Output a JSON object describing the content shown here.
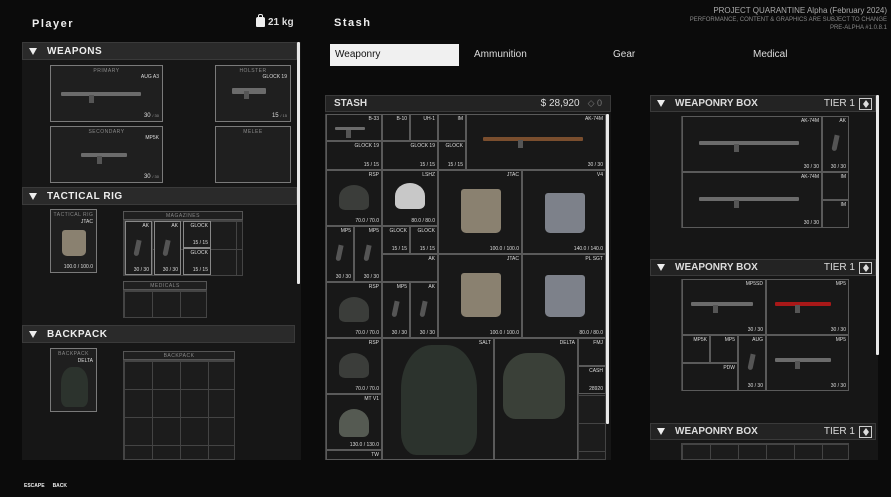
{
  "player": {
    "title": "Player",
    "weight": "21 kg"
  },
  "stash_title": "Stash",
  "build": {
    "line1": "PROJECT QUARANTINE Alpha (February 2024)",
    "line2": "PERFORMANCE, CONTENT & GRAPHICS ARE SUBJECT TO CHANGE",
    "line3": "PRE-ALPHA #1.0.8.1"
  },
  "weapons": {
    "title": "WEAPONS",
    "primary": {
      "label": "PRIMARY",
      "name": "AUG A3",
      "ammo": "30",
      "ammo_max": "/ 30"
    },
    "holster": {
      "label": "HOLSTER",
      "name": "GLOCK 19",
      "ammo": "15",
      "ammo_max": "/ 15"
    },
    "secondary": {
      "label": "SECONDARY",
      "name": "MP5K",
      "ammo": "30",
      "ammo_max": "/ 30"
    },
    "melee": {
      "label": "MELEE"
    }
  },
  "rig": {
    "title": "TACTICAL RIG",
    "slot_label": "TACTICAL RIG",
    "name": "JTAC",
    "capacity": "100.0 / 100.0",
    "magazines_label": "MAGAZINES",
    "mags": [
      {
        "name": "AK",
        "ammo": "30 / 30"
      },
      {
        "name": "AK",
        "ammo": "30 / 30"
      },
      {
        "name": "GLOCK",
        "ammo": "15 / 15"
      },
      {
        "name": "GLOCK",
        "ammo": "15 / 15"
      }
    ],
    "medicals_label": "MEDICALS"
  },
  "backpack": {
    "title": "BACKPACK",
    "slot_label": "BACKPACK",
    "name": "DELTA",
    "grid_label": "BACKPACK"
  },
  "tabs": [
    "Weaponry",
    "Ammunition",
    "Gear",
    "Medical"
  ],
  "stash": {
    "title": "STASH",
    "money": "28,920",
    "weight": "0",
    "cells": [
      {
        "n": "B-33",
        "a": ""
      },
      {
        "n": "B-10",
        "a": ""
      },
      {
        "n": "UH-1",
        "a": ""
      },
      {
        "n": "IM",
        "a": ""
      },
      {
        "n": "AK-74M",
        "a": "30 / 30"
      },
      {
        "n": "GLOCK 19",
        "a": "15 / 15"
      },
      {
        "n": "GLOCK 19",
        "a": "15 / 15"
      },
      {
        "n": "GLOCK",
        "a": "15 / 15"
      },
      {
        "n": "RSP",
        "a": "70.0 / 70.0"
      },
      {
        "n": "LSHZ",
        "a": "80.0 / 80.0"
      },
      {
        "n": "JTAC",
        "a": "100.0 / 100.0"
      },
      {
        "n": "V4",
        "a": "140.0 / 140.0"
      },
      {
        "n": "MP5",
        "a": "30 / 30"
      },
      {
        "n": "MP5",
        "a": "30 / 30"
      },
      {
        "n": "GLOCK",
        "a": "15 / 15"
      },
      {
        "n": "GLOCK",
        "a": "15 / 15"
      },
      {
        "n": "AK",
        "a": ""
      },
      {
        "n": "RSP",
        "a": "70.0 / 70.0"
      },
      {
        "n": "MP5",
        "a": "30 / 30"
      },
      {
        "n": "AK",
        "a": "30 / 30"
      },
      {
        "n": "JTAC",
        "a": "100.0 / 100.0"
      },
      {
        "n": "PL SGT",
        "a": "80.0 / 80.0"
      },
      {
        "n": "RSP",
        "a": "70.0 / 70.0"
      },
      {
        "n": "SALT",
        "a": ""
      },
      {
        "n": "DELTA",
        "a": ""
      },
      {
        "n": "FMJ",
        "a": ""
      },
      {
        "n": "CASH",
        "a": "28920"
      },
      {
        "n": "MT V1",
        "a": "130.0 / 130.0"
      },
      {
        "n": "TW",
        "a": ""
      }
    ]
  },
  "boxes": [
    {
      "title": "WEAPONRY BOX",
      "tier": "TIER 1",
      "cells": [
        {
          "n": "AK-74M",
          "a": "30 / 30"
        },
        {
          "n": "AK",
          "a": "30 / 30"
        },
        {
          "n": "AK-74M",
          "a": "30 / 30"
        },
        {
          "n": "IM",
          "a": ""
        },
        {
          "n": "IM",
          "a": ""
        }
      ]
    },
    {
      "title": "WEAPONRY BOX",
      "tier": "TIER 1",
      "cells": [
        {
          "n": "MP5SD",
          "a": "30 / 30"
        },
        {
          "n": "MP5",
          "a": "30 / 30"
        },
        {
          "n": "MP5K",
          "a": ""
        },
        {
          "n": "MP5",
          "a": ""
        },
        {
          "n": "AUG",
          "a": "30 / 30"
        },
        {
          "n": "MP5",
          "a": "30 / 30"
        },
        {
          "n": "PDW",
          "a": ""
        }
      ]
    },
    {
      "title": "WEAPONRY BOX",
      "tier": "TIER 1"
    }
  ],
  "footer": {
    "escape": "ESCAPE",
    "back": "BACK"
  }
}
